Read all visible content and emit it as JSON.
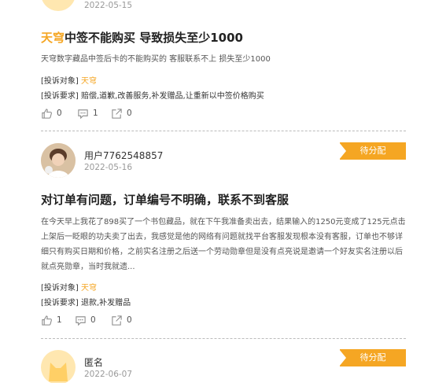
{
  "posts": [
    {
      "date": "2022-05-15",
      "title_brand": "天穹",
      "title_rest": "中签不能购买 导致损失至少1000",
      "description": "天穹数字藏品中签后卡的不能购买的 客服联系不上 损失至少1000",
      "target_label": "[投诉对象]",
      "target_value": "天穹",
      "request_label": "[投诉要求]",
      "request_value": "赔偿,道歉,改善服务,补发赠品,让重新以中签价格购买",
      "likes": "0",
      "comments": "1",
      "shares": "0"
    },
    {
      "user": "用户7762548857",
      "date": "2022-05-16",
      "status": "待分配",
      "title": "对订单有问题，订单编号不明确，联系不到客服",
      "description": "在今天早上我花了898买了一个书包藏品，就在下午我准备卖出去，结果输入的1250元变成了125元点击上架后一眨眼的功夫卖了出去，我感觉是他的网络有问题就找平台客服发现根本没有客服，订单也不够详细只有购买日期和价格，之前实名注册之后送一个劳动勋章但是没有点亮说是邀请一个好友实名注册以后就点亮勋章，当时我就遗...",
      "target_label": "[投诉对象]",
      "target_value": "天穹",
      "request_label": "[投诉要求]",
      "request_value": "退款,补发赠品",
      "likes": "1",
      "comments": "0",
      "shares": "0"
    },
    {
      "user": "匿名",
      "date": "2022-06-07",
      "status": "待分配"
    }
  ],
  "colors": {
    "accent": "#f5a623"
  },
  "icons": [
    "like-icon",
    "comment-icon",
    "share-icon"
  ]
}
